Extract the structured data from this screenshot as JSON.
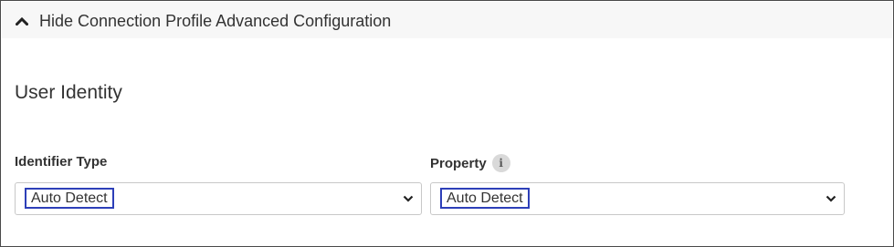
{
  "advanced_toggle": {
    "label": "Hide Connection Profile Advanced Configuration",
    "icon": "chevron-up-icon"
  },
  "section": {
    "title": "User Identity"
  },
  "identifier_type": {
    "label": "Identifier Type",
    "selected": "Auto Detect",
    "icon": "chevron-down-icon"
  },
  "property": {
    "label": "Property",
    "info_icon_glyph": "i",
    "selected": "Auto Detect",
    "icon": "chevron-down-icon"
  },
  "colors": {
    "highlight_border": "#2d3fb8",
    "frame_border": "#4a4a4a",
    "text": "#333333"
  }
}
